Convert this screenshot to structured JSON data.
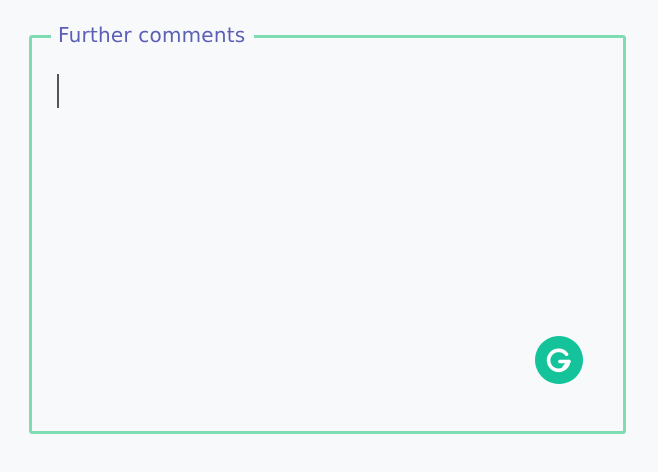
{
  "comments_field": {
    "label": "Further comments",
    "value": "",
    "placeholder": ""
  },
  "colors": {
    "border": "#7ddcb2",
    "label": "#5b5fb6",
    "background": "#f7f9fb",
    "grammarly": "#15c39a"
  },
  "icons": {
    "grammarly": "grammarly-icon"
  }
}
